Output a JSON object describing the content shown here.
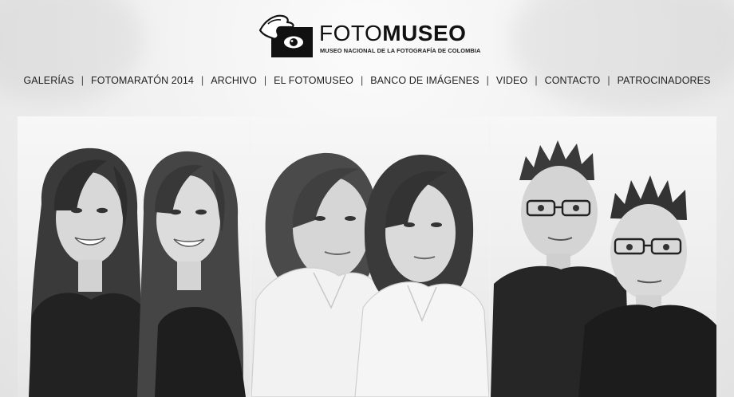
{
  "logo": {
    "wordmark_light": "FOTO",
    "wordmark_bold": "MUSEO",
    "tagline": "MUSEO NACIONAL DE LA FOTOGRAFÍA DE COLOMBIA",
    "icon": "hand-eye-icon"
  },
  "nav": {
    "items": [
      {
        "label": "GALERÍAS"
      },
      {
        "label": "FOTOMARATÓN 2014"
      },
      {
        "label": "ARCHIVO"
      },
      {
        "label": "EL FOTOMUSEO"
      },
      {
        "label": "BANCO DE IMÁGENES"
      },
      {
        "label": "VIDEO"
      },
      {
        "label": "CONTACTO"
      },
      {
        "label": "PATROCINADORES"
      }
    ],
    "separator": "|"
  },
  "photos": [
    {
      "subject": "twin-sisters-smiling"
    },
    {
      "subject": "twin-women-white-shirts"
    },
    {
      "subject": "twin-men-glasses"
    }
  ]
}
